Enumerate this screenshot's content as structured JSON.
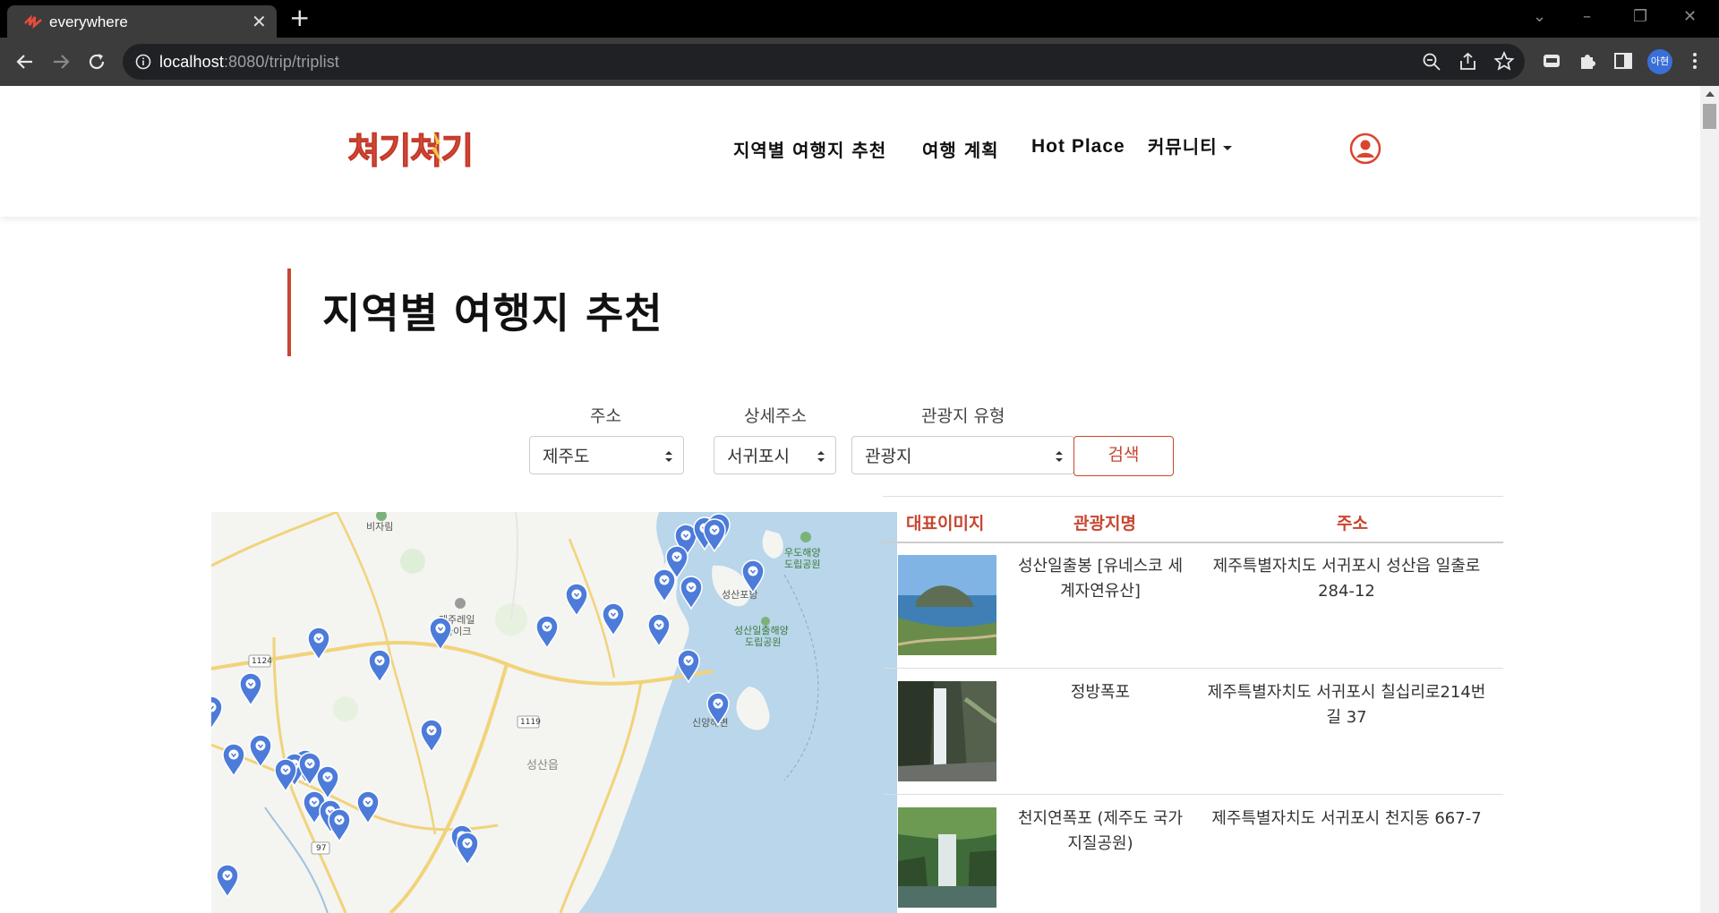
{
  "browser": {
    "tab_title": "everywhere",
    "url_host": "localhost",
    "url_path": ":8080/trip/triplist",
    "profile_label": "아현"
  },
  "header": {
    "logo_text": "쳐기쳐기",
    "nav": [
      "지역별 여행지 추천",
      "여행 계획",
      "Hot Place",
      "커뮤니티"
    ]
  },
  "page_title": "지역별 여행지 추천",
  "filters": {
    "address_label": "주소",
    "address_value": "제주도",
    "detail_label": "상세주소",
    "detail_value": "서귀포시",
    "type_label": "관광지 유형",
    "type_value": "관광지",
    "search_label": "검색"
  },
  "map_labels": {
    "bijarim": "비자림",
    "jeju_rail_1": "제주레일",
    "jeju_rail_2": "바이크",
    "udo_1": "우도해양",
    "udo_2": "도립공원",
    "seongsan_port": "성산포항",
    "seongsan_sunrise_1": "성산일출해양",
    "seongsan_sunrise_2": "도립공원",
    "sinyang": "신양해변",
    "seongsan_eup": "성산읍",
    "road_1124": "1124",
    "road_1119": "1119",
    "road_97": "97"
  },
  "table": {
    "headers": [
      "대표이미지",
      "관광지명",
      "주소"
    ],
    "rows": [
      {
        "name": "성산일출봉 [유네스코 세계자연유산]",
        "address": "제주특별자치도 서귀포시 성산읍 일출로 284-12"
      },
      {
        "name": "정방폭포",
        "address": "제주특별자치도 서귀포시 칠십리로214번길 37"
      },
      {
        "name": "천지연폭포 (제주도 국가지질공원)",
        "address": "제주특별자치도 서귀포시 천지동 667-7"
      }
    ]
  },
  "colors": {
    "accent": "#c8462f",
    "marker": "#4c7bd9",
    "sea": "#b9d6ea"
  }
}
